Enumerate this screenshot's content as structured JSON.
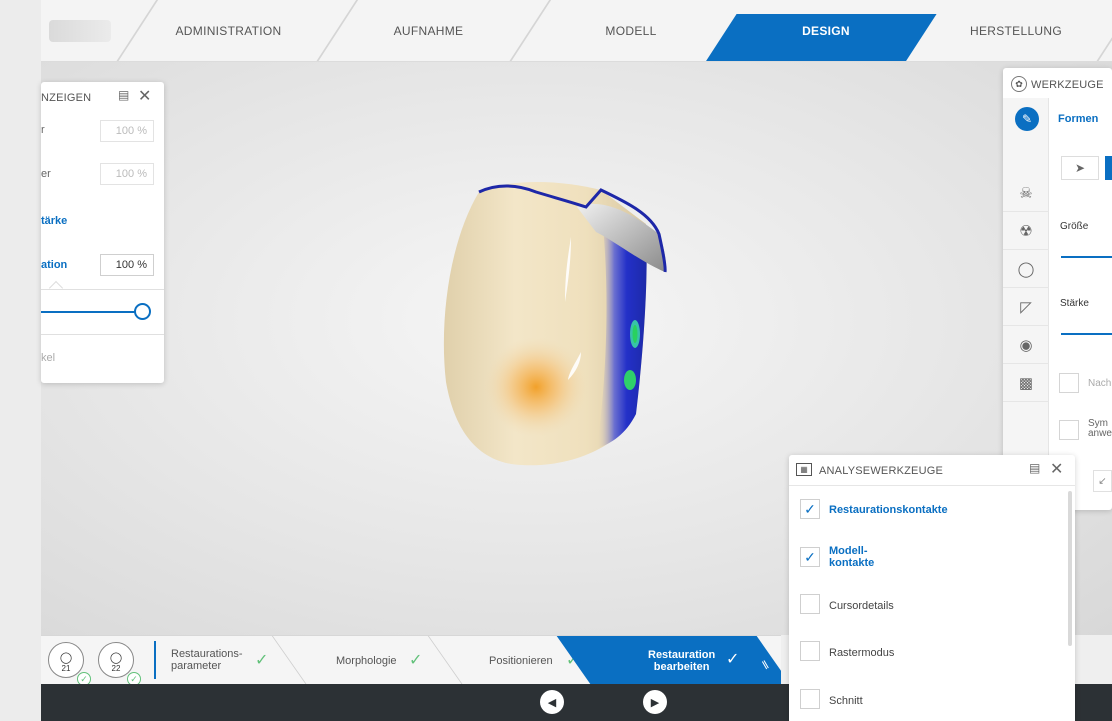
{
  "tabs": [
    {
      "label": "ADMINISTRATION"
    },
    {
      "label": "AUFNAHME"
    },
    {
      "label": "MODELL"
    },
    {
      "label": "DESIGN",
      "active": true
    },
    {
      "label": "HERSTELLUNG"
    }
  ],
  "anzeigen_panel": {
    "title": "NZEIGEN",
    "rows": [
      {
        "label": "r",
        "value": "100 %"
      },
      {
        "label": "er",
        "value": "100 %"
      }
    ],
    "section": "tärke",
    "active_row": {
      "label": "ation",
      "value": "100 %"
    },
    "slider_value": 1.0,
    "footer": "kel"
  },
  "werkzeuge_panel": {
    "title": "WERKZEUGE",
    "mode": "Formen",
    "size_label": "Größe",
    "strength_label": "Stärke",
    "option1": "Nach",
    "option2_line1": "Sym",
    "option2_line2": "anwe"
  },
  "analyse_panel": {
    "title": "ANALYSEWERKZEUGE",
    "items": [
      {
        "label": "Restaurationskontakte",
        "checked": true
      },
      {
        "label": "Modell-\nkontakte",
        "checked": true
      },
      {
        "label": "Cursordetails",
        "checked": false
      },
      {
        "label": "Rastermodus",
        "checked": false
      },
      {
        "label": "Schnitt",
        "checked": false
      }
    ]
  },
  "wizard": {
    "teeth": [
      "21",
      "22"
    ],
    "steps": [
      {
        "label": "Restaurations-\nparameter",
        "done": true
      },
      {
        "label": "Morphologie",
        "done": true
      },
      {
        "label": "Positionieren",
        "done": true
      },
      {
        "label": "Restauration\nbearbeiten",
        "done": true,
        "active": true
      }
    ]
  },
  "colors": {
    "accent": "#0a6fc2",
    "ok": "#62c17a",
    "dark": "#2c3135"
  }
}
